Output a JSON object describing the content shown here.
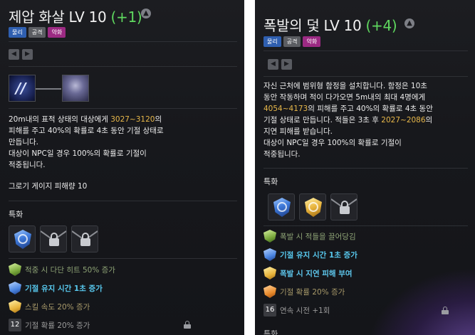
{
  "left": {
    "title": "제압 화살",
    "level": "LV 10",
    "bonus": "(+1)",
    "tags": [
      "물리",
      "공격",
      "약화"
    ],
    "desc_lines": [
      {
        "pre": "20m내의 표적 상태의 대상에게 ",
        "hl": "3027~3120",
        "post": "의"
      },
      {
        "pre": "피해를 주고 40%의 확률로 4초 동안 기절 상태로",
        "hl": "",
        "post": ""
      },
      {
        "pre": "만듭니다.",
        "hl": "",
        "post": ""
      },
      {
        "pre": "대상이 NPC일 경우 100%의 확률로 기절이",
        "hl": "",
        "post": ""
      },
      {
        "pre": "적중됩니다.",
        "hl": "",
        "post": ""
      }
    ],
    "extra_line": "그로기 게이지 피해량 10",
    "section_label": "특화",
    "traits": [
      {
        "text": "적중 시 다단 히트 50% 증가"
      },
      {
        "text": "기절 유지 시간 1초 증가"
      },
      {
        "text": "스킬 속도 20% 증가"
      },
      {
        "num": "12",
        "text": "기절 확률 20% 증가"
      }
    ]
  },
  "right": {
    "title": "폭발의 덫",
    "level": "LV 10",
    "bonus": "(+4)",
    "tags": [
      "물리",
      "공격",
      "약화"
    ],
    "desc_lines": [
      {
        "pre": "자신 근처에 범위형 함정을 설치합니다. 함정은 10초",
        "hl": "",
        "post": ""
      },
      {
        "pre": "동안 작동하며 적이 다가오면 5m내의 최대 4명에게",
        "hl": "",
        "post": ""
      },
      {
        "pre": "",
        "hl": "4054~4173",
        "post": "의 피해를 주고 40%의 확률로 4초 동안"
      },
      {
        "pre": "기절 상태로 만듭니다. 적들은 3초 후 ",
        "hl": "2027~2086",
        "post": "의"
      },
      {
        "pre": "지연 피해를 받습니다.",
        "hl": "",
        "post": ""
      },
      {
        "pre": "대상이 NPC일 경우 100%의 확률로 기절이",
        "hl": "",
        "post": ""
      },
      {
        "pre": "적중됩니다.",
        "hl": "",
        "post": ""
      }
    ],
    "section_label": "특화",
    "traits": [
      {
        "text": "폭발 시 적들을 끌어당김"
      },
      {
        "text": "기절 유지 시간 1초 증가"
      },
      {
        "text": "폭발 시 지연 피해 부여"
      },
      {
        "text": "기절 확률 20% 증가"
      },
      {
        "num": "16",
        "text": "연속 시전 +1회"
      }
    ],
    "bottom_partial": "특화"
  },
  "icons": {
    "info": "up-arrow-circle-icon",
    "nav_prev": "triangle-left-icon",
    "nav_next": "triangle-right-icon"
  }
}
